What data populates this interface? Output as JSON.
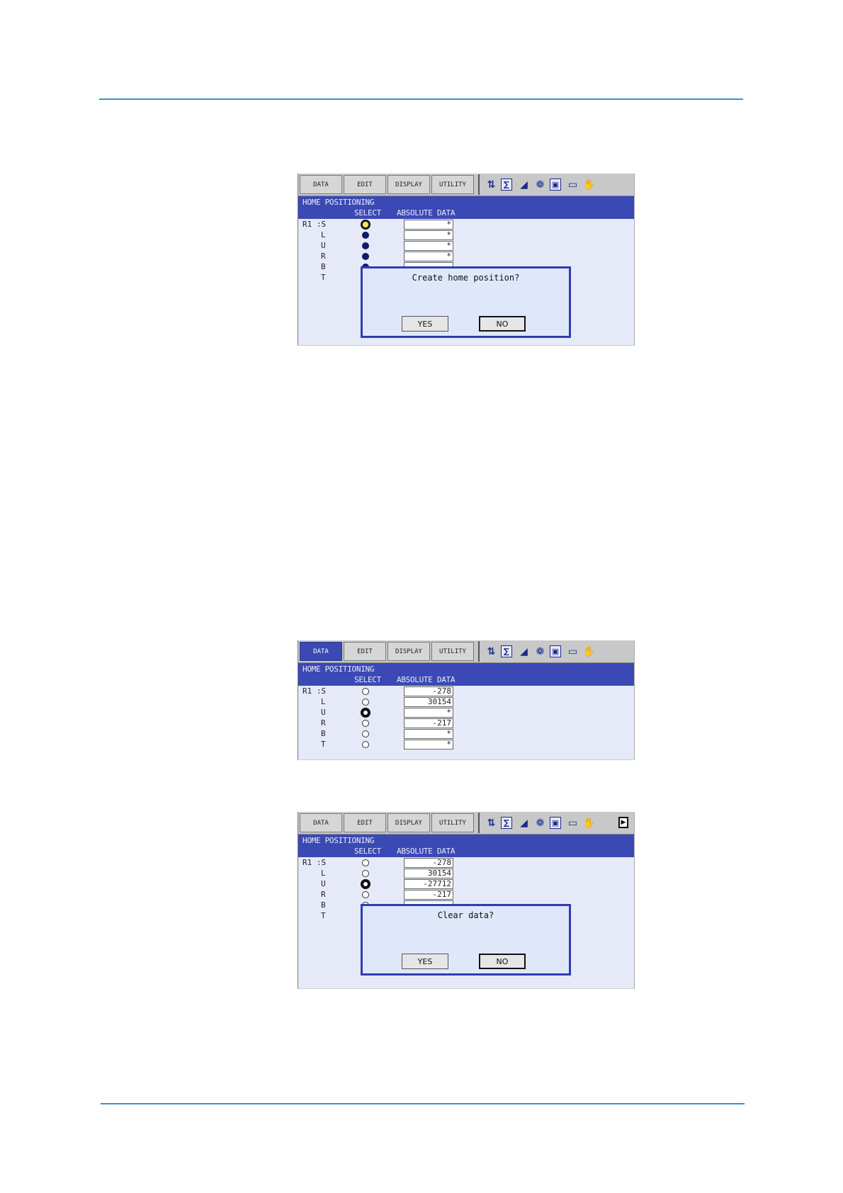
{
  "menu": [
    "DATA",
    "EDIT",
    "DISPLAY",
    "UTILITY"
  ],
  "screen_title": "HOME POSITIONING",
  "col_select": "SELECT",
  "col_absolute": "ABSOLUTE DATA",
  "axes": [
    "R1 :S",
    "L",
    "U",
    "R",
    "B",
    "T"
  ],
  "toolbar_icons": [
    "coordinate-icon",
    "step-icon",
    "speed-icon",
    "servo-icon",
    "teach-icon",
    "monitor-icon",
    "hand-icon"
  ],
  "screens": [
    {
      "active_menu": null,
      "show_page_icon": false,
      "rows": [
        {
          "select": "cursor-yellow",
          "value": "*"
        },
        {
          "select": "filled",
          "value": "*"
        },
        {
          "select": "filled",
          "value": "*"
        },
        {
          "select": "filled",
          "value": "*"
        },
        {
          "select": "filled",
          "value": ""
        },
        {
          "select": "filled",
          "value": ""
        }
      ],
      "dialog": {
        "message": "Create home position?",
        "yes": "YES",
        "no": "NO"
      }
    },
    {
      "active_menu": "DATA",
      "show_page_icon": false,
      "rows": [
        {
          "select": "hollow",
          "value": "-278"
        },
        {
          "select": "hollow",
          "value": "30154"
        },
        {
          "select": "cursor-black",
          "value": "*"
        },
        {
          "select": "hollow",
          "value": "-217"
        },
        {
          "select": "hollow",
          "value": "*"
        },
        {
          "select": "hollow",
          "value": "*"
        }
      ],
      "dialog": null
    },
    {
      "active_menu": null,
      "show_page_icon": true,
      "rows": [
        {
          "select": "hollow",
          "value": "-278"
        },
        {
          "select": "hollow",
          "value": "30154"
        },
        {
          "select": "cursor-black",
          "value": "-27712"
        },
        {
          "select": "hollow",
          "value": "-217"
        },
        {
          "select": "hollow",
          "value": ""
        },
        {
          "select": "hollow",
          "value": ""
        }
      ],
      "dialog": {
        "message": "Clear data?",
        "yes": "YES",
        "no": "NO"
      }
    }
  ]
}
